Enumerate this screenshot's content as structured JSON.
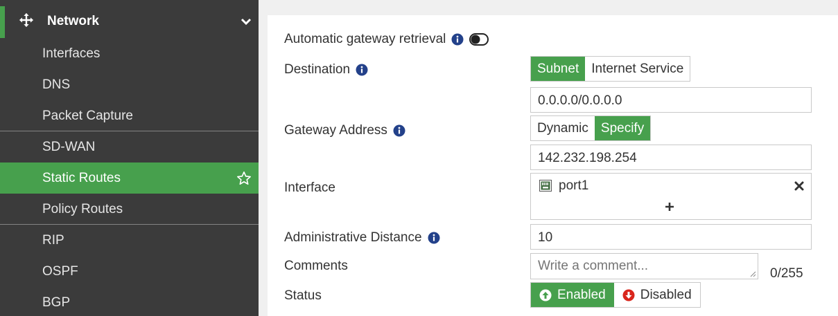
{
  "sidebar": {
    "section_title": "Network",
    "items": [
      {
        "label": "Interfaces"
      },
      {
        "label": "DNS"
      },
      {
        "label": "Packet Capture"
      },
      {
        "label": "SD-WAN"
      },
      {
        "label": "Static Routes"
      },
      {
        "label": "Policy Routes"
      },
      {
        "label": "RIP"
      },
      {
        "label": "OSPF"
      },
      {
        "label": "BGP"
      }
    ]
  },
  "form": {
    "auto_gateway": {
      "label": "Automatic gateway retrieval",
      "enabled": false
    },
    "destination": {
      "label": "Destination",
      "options": [
        "Subnet",
        "Internet Service"
      ],
      "selected": "Subnet",
      "value": "0.0.0.0/0.0.0.0"
    },
    "gateway": {
      "label": "Gateway Address",
      "options": [
        "Dynamic",
        "Specify"
      ],
      "selected": "Specify",
      "value": "142.232.198.254"
    },
    "interface": {
      "label": "Interface",
      "value": "port1",
      "add_symbol": "+"
    },
    "admin_distance": {
      "label": "Administrative Distance",
      "value": "10"
    },
    "comments": {
      "label": "Comments",
      "placeholder": "Write a comment...",
      "counter": "0/255"
    },
    "status": {
      "label": "Status",
      "options": [
        "Enabled",
        "Disabled"
      ],
      "selected": "Enabled"
    }
  },
  "colors": {
    "accent": "#47a04d",
    "sidebar_bg": "#3b3b3b",
    "disabled_icon": "#d9261c"
  },
  "icons": [
    "move-icon",
    "chevron-down-icon",
    "star-icon",
    "info-icon",
    "toggle-icon",
    "port-icon",
    "close-icon",
    "plus-icon",
    "arrow-up-circle-icon",
    "arrow-down-circle-icon"
  ]
}
